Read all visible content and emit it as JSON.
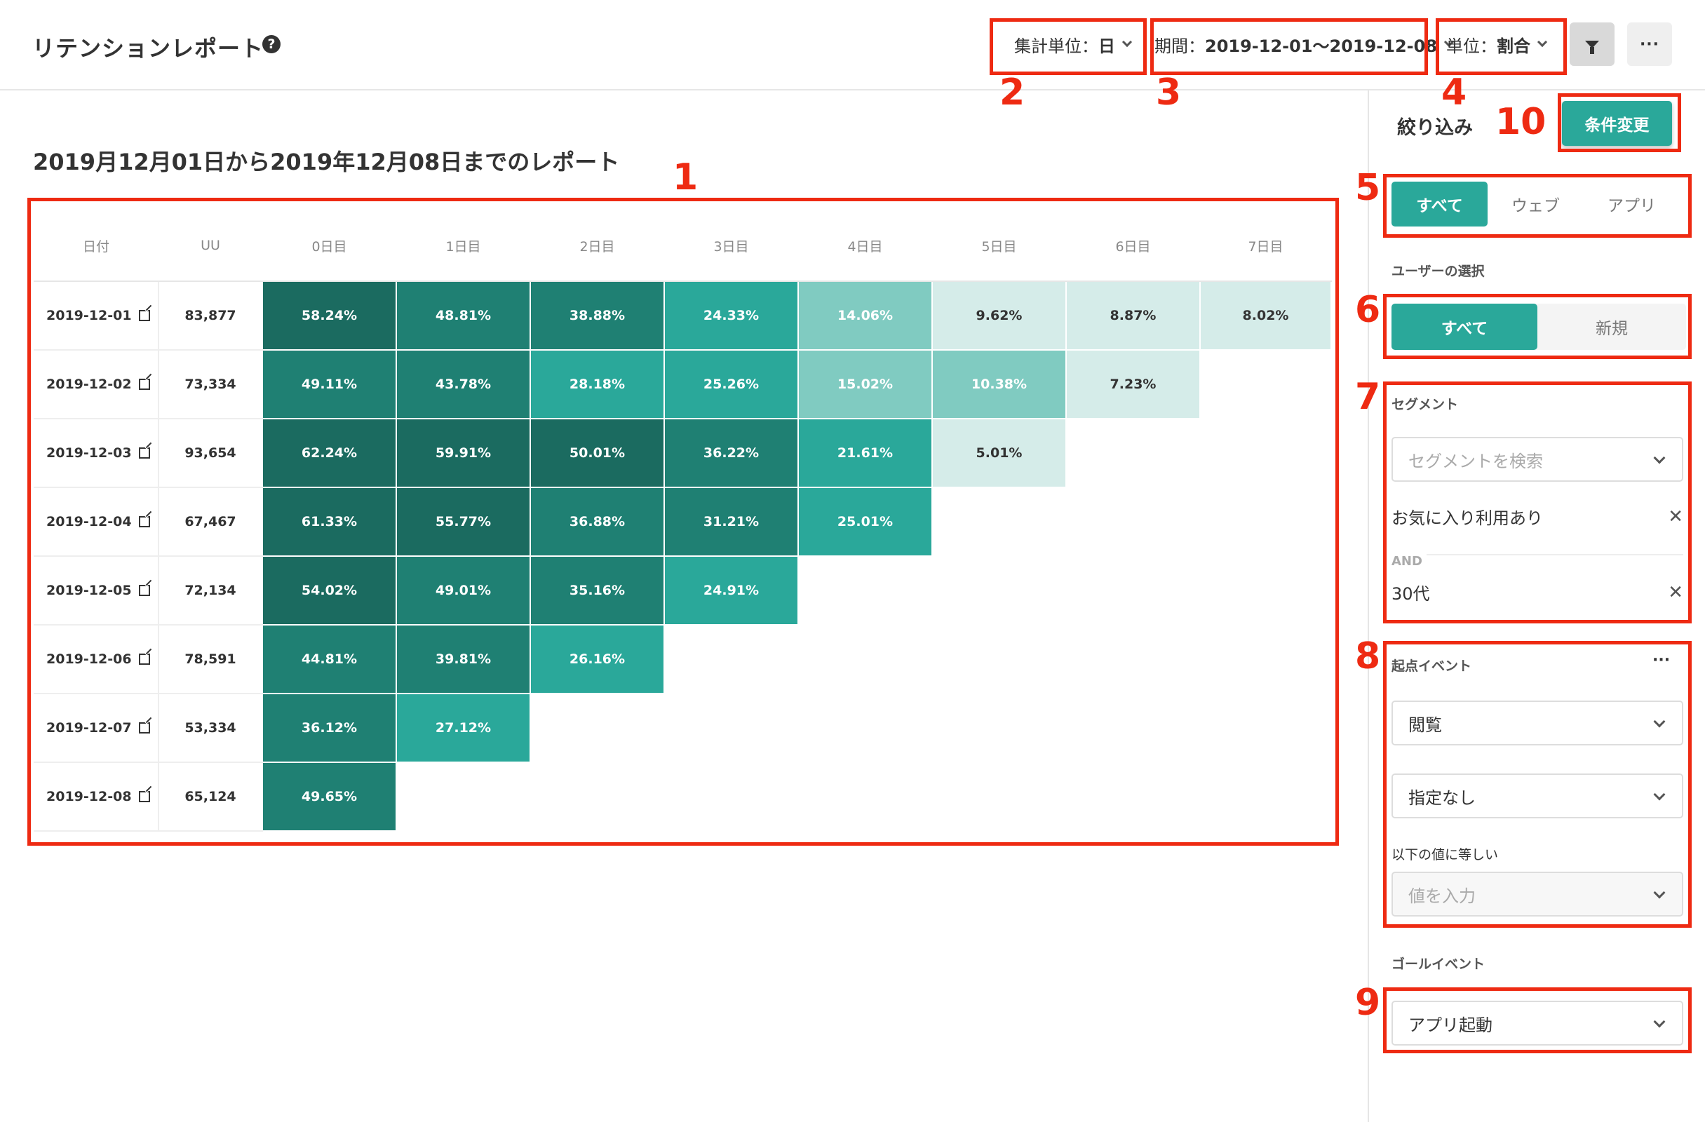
{
  "header": {
    "title": "リテンションレポート",
    "help_icon": "?",
    "aggregate": {
      "label": "集計単位：",
      "value": "日"
    },
    "period": {
      "label": "期間：",
      "value": "2019-12-01〜2019-12-08"
    },
    "unit": {
      "label": "単位：",
      "value": "割合"
    },
    "more_label": "···"
  },
  "report": {
    "title": "2019月12月01日から2019年12月08日までのレポート",
    "columns": [
      "日付",
      "UU",
      "0日目",
      "1日目",
      "2日目",
      "3日目",
      "4日目",
      "5日目",
      "6日目",
      "7日目"
    ],
    "rows": [
      {
        "date": "2019-12-01",
        "uu": "83,877",
        "cells": [
          "58.24%",
          "48.81%",
          "38.88%",
          "24.33%",
          "14.06%",
          "9.62%",
          "8.87%",
          "8.02%"
        ]
      },
      {
        "date": "2019-12-02",
        "uu": "73,334",
        "cells": [
          "49.11%",
          "43.78%",
          "28.18%",
          "25.26%",
          "15.02%",
          "10.38%",
          "7.23%"
        ]
      },
      {
        "date": "2019-12-03",
        "uu": "93,654",
        "cells": [
          "62.24%",
          "59.91%",
          "50.01%",
          "36.22%",
          "21.61%",
          "5.01%"
        ]
      },
      {
        "date": "2019-12-04",
        "uu": "67,467",
        "cells": [
          "61.33%",
          "55.77%",
          "36.88%",
          "31.21%",
          "25.01%"
        ]
      },
      {
        "date": "2019-12-05",
        "uu": "72,134",
        "cells": [
          "54.02%",
          "49.01%",
          "35.16%",
          "24.91%"
        ]
      },
      {
        "date": "2019-12-06",
        "uu": "78,591",
        "cells": [
          "44.81%",
          "39.81%",
          "26.16%"
        ]
      },
      {
        "date": "2019-12-07",
        "uu": "53,334",
        "cells": [
          "36.12%",
          "27.12%"
        ]
      },
      {
        "date": "2019-12-08",
        "uu": "65,124",
        "cells": [
          "49.65%"
        ]
      }
    ]
  },
  "colors": {
    "accent": "#2aa89a",
    "annotation": "#ee2a12",
    "heat_darkest": "#1b6b60",
    "heat_dark": "#1f8073",
    "heat_mid": "#2aa89a",
    "heat_light": "#80cbc1",
    "heat_lightest": "#d5ece9"
  },
  "sidebar": {
    "filter_heading": "絞り込み",
    "apply_label": "条件変更",
    "platform_tabs": [
      {
        "label": "すべて",
        "active": true
      },
      {
        "label": "ウェブ",
        "active": false
      },
      {
        "label": "アプリ",
        "active": false
      }
    ],
    "user_select_label": "ユーザーの選択",
    "user_tabs": [
      {
        "label": "すべて",
        "active": true
      },
      {
        "label": "新規",
        "active": false
      }
    ],
    "segment_label": "セグメント",
    "segment_search_placeholder": "セグメントを検索",
    "segments": [
      "お気に入り利用あり",
      "30代"
    ],
    "and_label": "AND",
    "origin_label": "起点イベント",
    "origin_more": "···",
    "origin_event": "閲覧",
    "origin_condition": "指定なし",
    "equals_label": "以下の値に等しい",
    "value_placeholder": "値を入力",
    "goal_label": "ゴールイベント",
    "goal_event": "アプリ起動"
  },
  "annotations": [
    "1",
    "2",
    "3",
    "4",
    "5",
    "6",
    "7",
    "8",
    "9",
    "10"
  ],
  "icons": [
    "help-icon",
    "chevron-down-icon",
    "filter-icon",
    "more-icon",
    "external-link-icon",
    "close-icon"
  ]
}
